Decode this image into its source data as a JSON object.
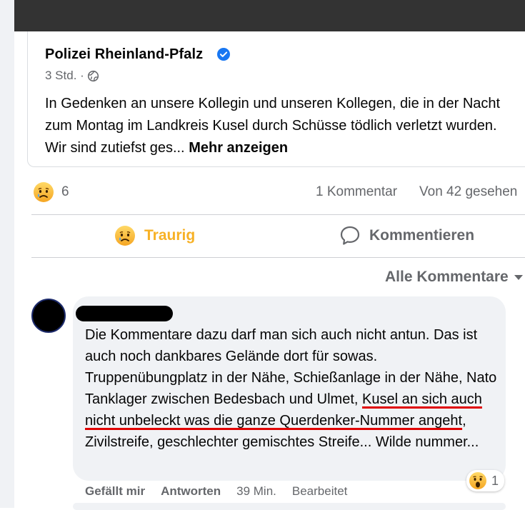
{
  "post": {
    "page_name": "Polizei Rheinland-Pfalz",
    "time": "3 Std. ·",
    "text": "In Gedenken an unsere Kollegin und unseren Kollegen, die in der Nacht zum Montag im Landkreis Kusel durch Schüsse tödlich verletzt wurden. Wir sind zutiefst ges...",
    "more_label": "Mehr anzeigen"
  },
  "stats": {
    "reaction_count": "6",
    "comments": "1 Kommentar",
    "views": "Von 42 gesehen"
  },
  "actions": {
    "sad_label": "Traurig",
    "comment_label": "Kommentieren"
  },
  "filter": {
    "label": "Alle Kommentare"
  },
  "comment": {
    "text_part1": "Die Kommentare dazu darf man sich auch nicht antun. Das ist auch noch dankbares Gelände dort für sowas. Truppenübungplatz in der Nähe, Schießanlage in der Nähe, Nato Tanklager zwischen Bedesbach und Ulmet, ",
    "text_underlined": "Kusel an sich auch nicht unbeleckt was die ganze Querdenker-Nummer angeht",
    "text_part2": ", Zivilstreife, geschlechter gemischtes Streife... Wilde nummer...",
    "reaction_count": "1",
    "like_label": "Gefällt mir",
    "reply_label": "Antworten",
    "time": "39 Min.",
    "edited": "Bearbeitet"
  },
  "colors": {
    "sad_accent": "#f7b125",
    "verified_blue": "#1877f2",
    "underline_red": "#e00000"
  }
}
